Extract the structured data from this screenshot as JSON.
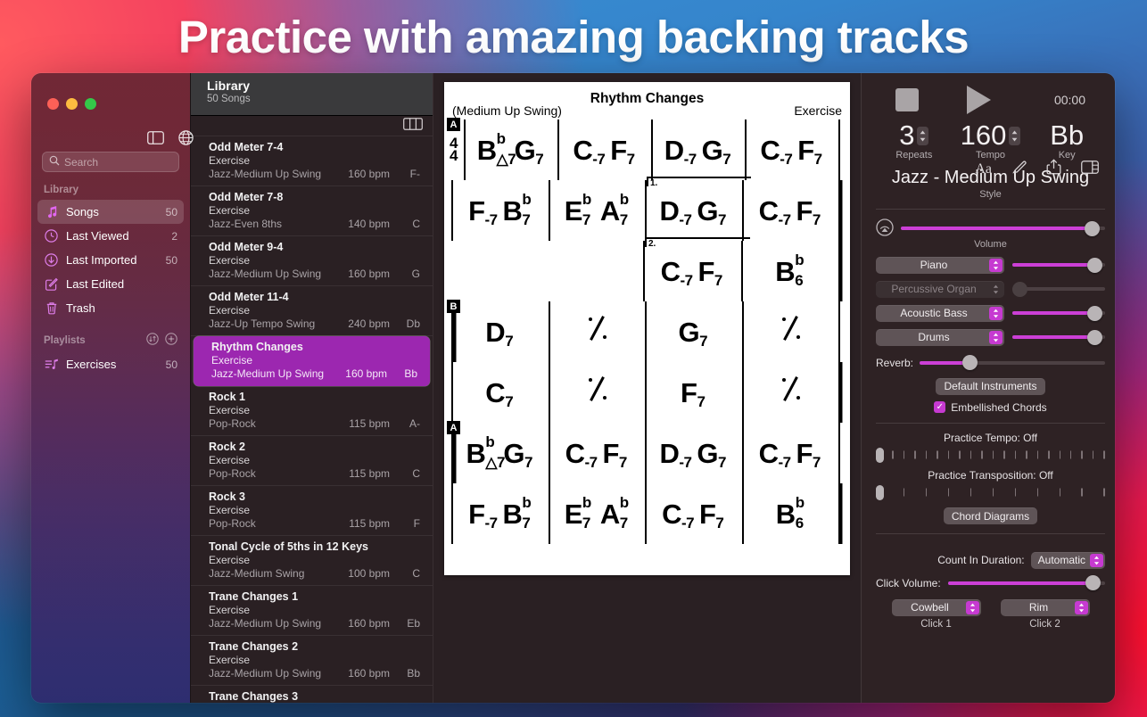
{
  "marketing": {
    "headline": "Practice with amazing backing tracks"
  },
  "window": {
    "traffic": {
      "close": "close-button",
      "minimize": "minimize-button",
      "zoom": "zoom-button"
    }
  },
  "sidebar": {
    "search": {
      "placeholder": "Search",
      "value": ""
    },
    "library_header": "Library",
    "library_items": [
      {
        "label": "Songs",
        "count": "50",
        "icon": "music-note-icon",
        "selected": true
      },
      {
        "label": "Last Viewed",
        "count": "2",
        "icon": "clock-icon",
        "selected": false
      },
      {
        "label": "Last Imported",
        "count": "50",
        "icon": "download-icon",
        "selected": false
      },
      {
        "label": "Last Edited",
        "count": "",
        "icon": "pencil-square-icon",
        "selected": false
      },
      {
        "label": "Trash",
        "count": "",
        "icon": "trash-icon",
        "selected": false
      }
    ],
    "playlists_header": "Playlists",
    "playlists": [
      {
        "label": "Exercises",
        "count": "50",
        "icon": "playlist-icon"
      }
    ]
  },
  "list_header": {
    "title": "Library",
    "subtitle": "50 Songs"
  },
  "songs": [
    {
      "name": "Odd Meter 7-4",
      "type": "Exercise",
      "style": "Jazz-Medium Up Swing",
      "bpm": "160 bpm",
      "key": "F-",
      "active": false
    },
    {
      "name": "Odd Meter 7-8",
      "type": "Exercise",
      "style": "Jazz-Even 8ths",
      "bpm": "140 bpm",
      "key": "C",
      "active": false
    },
    {
      "name": "Odd Meter 9-4",
      "type": "Exercise",
      "style": "Jazz-Medium Up Swing",
      "bpm": "160 bpm",
      "key": "G",
      "active": false
    },
    {
      "name": "Odd Meter 11-4",
      "type": "Exercise",
      "style": "Jazz-Up Tempo Swing",
      "bpm": "240 bpm",
      "key": "Db",
      "active": false
    },
    {
      "name": "Rhythm Changes",
      "type": "Exercise",
      "style": "Jazz-Medium Up Swing",
      "bpm": "160 bpm",
      "key": "Bb",
      "active": true
    },
    {
      "name": "Rock 1",
      "type": "Exercise",
      "style": "Pop-Rock",
      "bpm": "115 bpm",
      "key": "A-",
      "active": false
    },
    {
      "name": "Rock 2",
      "type": "Exercise",
      "style": "Pop-Rock",
      "bpm": "115 bpm",
      "key": "C",
      "active": false
    },
    {
      "name": "Rock 3",
      "type": "Exercise",
      "style": "Pop-Rock",
      "bpm": "115 bpm",
      "key": "F",
      "active": false
    },
    {
      "name": "Tonal Cycle of 5ths in 12 Keys",
      "type": "Exercise",
      "style": "Jazz-Medium Swing",
      "bpm": "100 bpm",
      "key": "C",
      "active": false
    },
    {
      "name": "Trane Changes 1",
      "type": "Exercise",
      "style": "Jazz-Medium Up Swing",
      "bpm": "160 bpm",
      "key": "Eb",
      "active": false
    },
    {
      "name": "Trane Changes 2",
      "type": "Exercise",
      "style": "Jazz-Medium Up Swing",
      "bpm": "160 bpm",
      "key": "Bb",
      "active": false
    },
    {
      "name": "Trane Changes 3",
      "type": "",
      "style": "",
      "bpm": "",
      "key": "",
      "active": false
    }
  ],
  "toolbar": {
    "text_icon": "Aa",
    "icons": [
      "text-format-icon",
      "pencil-icon",
      "share-icon",
      "inspector-toggle-icon"
    ]
  },
  "score": {
    "title": "Rhythm Changes",
    "subtitle": "(Medium Up Swing)",
    "right_label": "Exercise",
    "time_signature_top": "4",
    "time_signature_bottom": "4",
    "systems": [
      {
        "rehearsal": "A",
        "measures": [
          {
            "chords": [
              {
                "root": "B",
                "sup": "b",
                "sub": "△7"
              },
              {
                "root": "G",
                "sub": "7"
              }
            ]
          },
          {
            "chords": [
              {
                "root": "C",
                "sub": "-7"
              },
              {
                "root": "F",
                "sub": "7"
              }
            ]
          },
          {
            "chords": [
              {
                "root": "D",
                "sub": "-7"
              },
              {
                "root": "G",
                "sub": "7"
              }
            ]
          },
          {
            "chords": [
              {
                "root": "C",
                "sub": "-7"
              },
              {
                "root": "F",
                "sub": "7"
              }
            ]
          }
        ]
      },
      {
        "rehearsal": "",
        "measures": [
          {
            "chords": [
              {
                "root": "F",
                "sub": "-7"
              },
              {
                "root": "B",
                "sup": "b",
                "sub": "7"
              }
            ]
          },
          {
            "chords": [
              {
                "root": "E",
                "sup": "b",
                "sub": "7"
              },
              {
                "root": "A",
                "sup": "b",
                "sub": "7"
              }
            ]
          },
          {
            "ending": "1.",
            "chords": [
              {
                "root": "D",
                "sub": "-7"
              },
              {
                "root": "G",
                "sub": "7"
              }
            ]
          },
          {
            "chords": [
              {
                "root": "C",
                "sub": "-7"
              },
              {
                "root": "F",
                "sub": "7"
              }
            ]
          }
        ]
      },
      {
        "rehearsal": "",
        "measures": [
          {
            "chords": []
          },
          {
            "chords": []
          },
          {
            "ending": "2.",
            "chords": [
              {
                "root": "C",
                "sub": "-7"
              },
              {
                "root": "F",
                "sub": "7"
              }
            ]
          },
          {
            "chords": [
              {
                "root": "B",
                "sup": "b",
                "sub": "6"
              }
            ]
          }
        ]
      },
      {
        "rehearsal": "B",
        "measures": [
          {
            "chords": [
              {
                "root": "D",
                "sub": "7"
              }
            ]
          },
          {
            "repeat": "╱"
          },
          {
            "chords": [
              {
                "root": "G",
                "sub": "7"
              }
            ]
          },
          {
            "repeat": "╱"
          }
        ]
      },
      {
        "rehearsal": "",
        "measures": [
          {
            "chords": [
              {
                "root": "C",
                "sub": "7"
              }
            ]
          },
          {
            "repeat": "╱"
          },
          {
            "chords": [
              {
                "root": "F",
                "sub": "7"
              }
            ]
          },
          {
            "repeat": "╱"
          }
        ]
      },
      {
        "rehearsal": "A",
        "measures": [
          {
            "chords": [
              {
                "root": "B",
                "sup": "b",
                "sub": "△7"
              },
              {
                "root": "G",
                "sub": "7"
              }
            ]
          },
          {
            "chords": [
              {
                "root": "C",
                "sub": "-7"
              },
              {
                "root": "F",
                "sub": "7"
              }
            ]
          },
          {
            "chords": [
              {
                "root": "D",
                "sub": "-7"
              },
              {
                "root": "G",
                "sub": "7"
              }
            ]
          },
          {
            "chords": [
              {
                "root": "C",
                "sub": "-7"
              },
              {
                "root": "F",
                "sub": "7"
              }
            ]
          }
        ]
      },
      {
        "rehearsal": "",
        "measures": [
          {
            "chords": [
              {
                "root": "F",
                "sub": "-7"
              },
              {
                "root": "B",
                "sup": "b",
                "sub": "7"
              }
            ]
          },
          {
            "chords": [
              {
                "root": "E",
                "sup": "b",
                "sub": "7"
              },
              {
                "root": "A",
                "sup": "b",
                "sub": "7"
              }
            ]
          },
          {
            "chords": [
              {
                "root": "C",
                "sub": "-7"
              },
              {
                "root": "F",
                "sub": "7"
              }
            ]
          },
          {
            "chords": [
              {
                "root": "B",
                "sup": "b",
                "sub": "6"
              }
            ]
          }
        ]
      }
    ]
  },
  "inspector": {
    "time": "00:00",
    "repeats": {
      "value": "3",
      "label": "Repeats"
    },
    "tempo": {
      "value": "160",
      "label": "Tempo"
    },
    "key": {
      "value": "Bb",
      "label": "Key"
    },
    "style_name": "Jazz - Medium Up Swing",
    "style_label": "Style",
    "volume": {
      "label": "Volume",
      "percent": 97
    },
    "instruments": [
      {
        "name": "Piano",
        "percent": 97,
        "enabled": true
      },
      {
        "name": "Percussive Organ",
        "percent": 0,
        "enabled": false
      },
      {
        "name": "Acoustic Bass",
        "percent": 97,
        "enabled": true
      },
      {
        "name": "Drums",
        "percent": 97,
        "enabled": true
      }
    ],
    "reverb": {
      "label": "Reverb:",
      "percent": 25
    },
    "default_instruments_button": "Default Instruments",
    "embellished_chords": {
      "label": "Embellished Chords",
      "checked": true,
      "check_glyph": "✓"
    },
    "practice_tempo": {
      "label": "Practice Tempo: Off",
      "ticks": 21,
      "knob_percent": 0
    },
    "practice_transposition": {
      "label": "Practice Transposition: Off",
      "ticks": 11,
      "knob_percent": 0
    },
    "chord_diagrams_button": "Chord Diagrams",
    "count_in": {
      "label": "Count In Duration:",
      "value": "Automatic"
    },
    "click_volume": {
      "label": "Click Volume:",
      "percent": 97
    },
    "click1": {
      "value": "Cowbell",
      "caption": "Click 1"
    },
    "click2": {
      "value": "Rim",
      "caption": "Click 2"
    }
  }
}
